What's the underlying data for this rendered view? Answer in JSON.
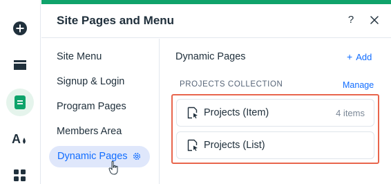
{
  "header": {
    "title": "Site Pages and Menu",
    "help_label": "?"
  },
  "rail": {
    "icons": [
      "add-icon",
      "sections-icon",
      "pages-icon",
      "theme-icon",
      "apps-icon"
    ],
    "accent_color": "#0fa36b"
  },
  "menu": {
    "items": [
      {
        "label": "Site Menu"
      },
      {
        "label": "Signup & Login"
      },
      {
        "label": "Program Pages"
      },
      {
        "label": "Members Area"
      },
      {
        "label": "Dynamic Pages",
        "selected": true
      }
    ]
  },
  "content": {
    "title": "Dynamic Pages",
    "add_label": "Add",
    "add_plus": "+",
    "collection_label": "PROJECTS COLLECTION",
    "manage_label": "Manage",
    "pages": [
      {
        "label": "Projects (Item)",
        "count": "4 items"
      },
      {
        "label": "Projects (List)",
        "count": ""
      }
    ]
  },
  "colors": {
    "link": "#116dff",
    "highlight_border": "#e8654c",
    "selected_bg": "#dfe7fb"
  }
}
